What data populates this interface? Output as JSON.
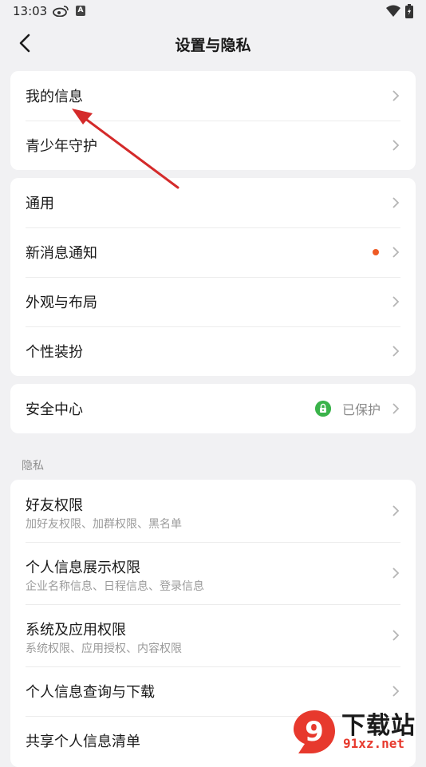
{
  "status_bar": {
    "time": "13:03",
    "icons": [
      "weibo-icon",
      "a-icon",
      "wifi-icon",
      "battery-icon"
    ],
    "a_glyph": "A"
  },
  "header": {
    "title": "设置与隐私",
    "back_icon": "back-icon"
  },
  "groups": [
    {
      "items": [
        {
          "label": "我的信息"
        },
        {
          "label": "青少年守护"
        }
      ]
    },
    {
      "items": [
        {
          "label": "通用"
        },
        {
          "label": "新消息通知",
          "has_red_dot": true
        },
        {
          "label": "外观与布局"
        },
        {
          "label": "个性装扮"
        }
      ]
    },
    {
      "items": [
        {
          "label": "安全中心",
          "status": "已保护",
          "status_icon": "lock-icon"
        }
      ]
    }
  ],
  "privacy_section": {
    "header": "隐私",
    "items": [
      {
        "label": "好友权限",
        "sub": "加好友权限、加群权限、黑名单"
      },
      {
        "label": "个人信息展示权限",
        "sub": "企业名称信息、日程信息、登录信息"
      },
      {
        "label": "系统及应用权限",
        "sub": "系统权限、应用授权、内容权限"
      },
      {
        "label": "个人信息查询与下载"
      },
      {
        "label": "共享个人信息清单"
      }
    ]
  },
  "colors": {
    "accent_dot": "#ee5a24",
    "protect_green": "#3ab34a",
    "arrow_red": "#d42a2a",
    "background": "#f1f1f3"
  },
  "watermark": {
    "logo_glyph": "9",
    "title": "下载站",
    "url": "91xz.net"
  }
}
